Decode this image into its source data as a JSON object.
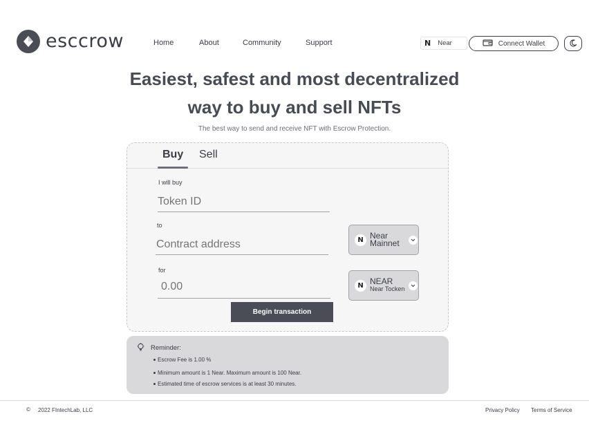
{
  "header": {
    "logo_text": "esccrow",
    "nav": [
      "Home",
      "About",
      "Community",
      "Support"
    ],
    "network_label": "Near",
    "network_icon": "near-logo-icon",
    "connect_wallet_label": "Connect Wallet",
    "wallet_icon": "wallet-icon",
    "theme_icon": "moon-icon"
  },
  "hero": {
    "title_line1": "Easiest, safest and most decentralized",
    "title_line2": "way to buy and sell NFTs",
    "subtitle": "The best way to send and receive NFT with Escrow Protection."
  },
  "trade_card": {
    "tabs": [
      {
        "label": "Buy",
        "active": true
      },
      {
        "label": "Sell",
        "active": false
      }
    ],
    "token_label": "I will buy",
    "token_placeholder": "Token ID",
    "contract_label": "to",
    "contract_placeholder": "Contract address",
    "amount_label": "for",
    "amount_placeholder": "0.00",
    "network_select": {
      "line1": "Near",
      "line2": "Mainnet"
    },
    "token_select": {
      "line1": "NEAR",
      "line2": "Near Tocken"
    },
    "begin_label": "Begin transaction"
  },
  "reminder": {
    "title": "Reminder:",
    "icon": "lightbulb-icon",
    "items": [
      "Escrow Fee is 1.00 %",
      "Minimum amount is 1 Near. Maximum amount is 100 Near.",
      "Estimated time of escrow services is at least 30 minutes."
    ]
  },
  "footer": {
    "copyright": "2022 FIntechLab, LLC",
    "privacy": "Privacy Policy",
    "terms": "Terms of Service"
  },
  "colors": {
    "primary_dark": "#4a4d55",
    "card_bg": "#f6f6f7",
    "reminder_bg": "#d9d9dc",
    "text": "#3a3d45"
  }
}
